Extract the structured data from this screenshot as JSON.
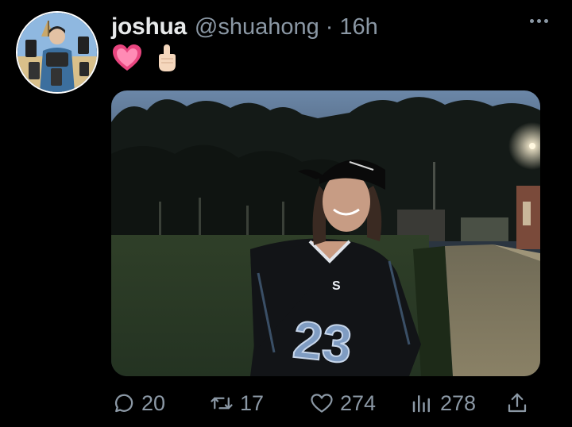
{
  "tweet": {
    "author": {
      "display_name": "joshua",
      "handle": "@shuahong",
      "separator": "·",
      "timestamp": "16h"
    },
    "content": {
      "emojis": [
        "pink-heart",
        "raised-index-finger"
      ]
    },
    "media": {
      "type": "photo",
      "jersey_letter": "S",
      "jersey_number": "23"
    },
    "actions": {
      "replies": "20",
      "retweets": "17",
      "likes": "274",
      "views": "278"
    }
  },
  "colors": {
    "background": "#000000",
    "text_primary": "#e7e9ea",
    "text_secondary": "#8b98a5",
    "heart_emoji": "#e8457f"
  },
  "icons": [
    "more-icon",
    "reply-icon",
    "retweet-icon",
    "like-icon",
    "views-icon",
    "share-icon"
  ]
}
